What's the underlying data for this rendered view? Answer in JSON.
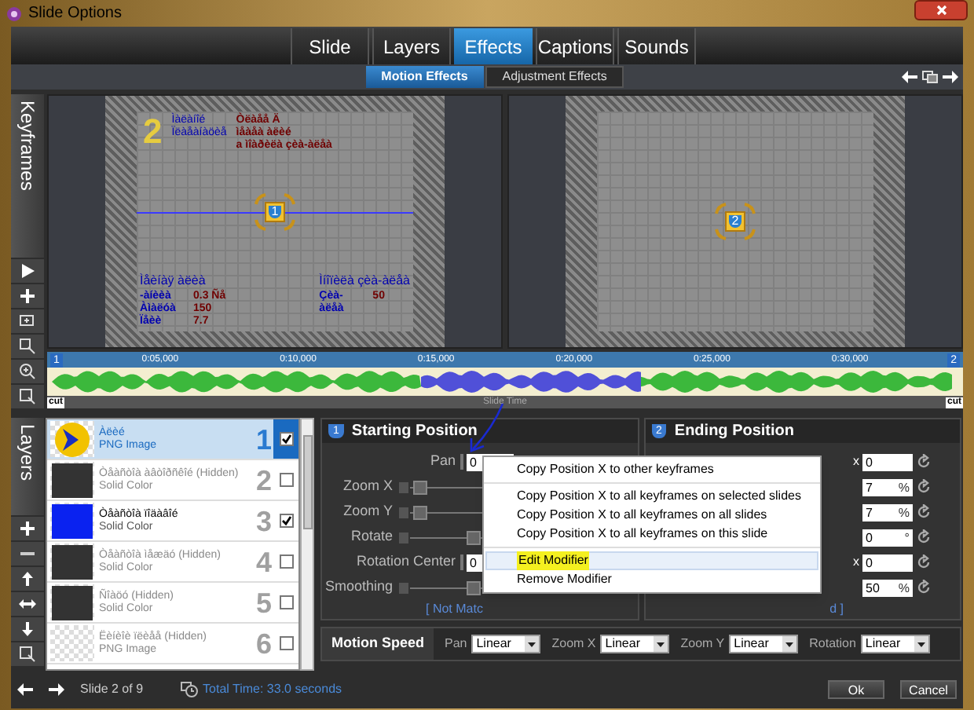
{
  "window": {
    "title": "Slide Options"
  },
  "tabs": [
    {
      "label": "Slide",
      "selected": false
    },
    {
      "label": "Layers",
      "selected": false
    },
    {
      "label": "Effects",
      "selected": true
    },
    {
      "label": "Captions",
      "selected": false
    },
    {
      "label": "Sounds",
      "selected": false
    }
  ],
  "subtabs": [
    {
      "label": "Motion Effects",
      "selected": true
    },
    {
      "label": "Adjustment Effects",
      "selected": false
    }
  ],
  "keyframes_label": "Keyframes",
  "preview": {
    "slide_number": "2",
    "title_lines": [
      "Ìàëàíîé",
      "Ïëàåàíàöèå"
    ],
    "red_lines": [
      "Òëàåå Ä",
      "ìåàåà àëèé",
      "a ìîàðèëà çèà-àëåà"
    ],
    "left_block": {
      "heading": "Ìåèíàÿ àëèà",
      "rows": [
        {
          "label": "-àíèèà",
          "value": "0.3 Ñå"
        },
        {
          "label": "Àìàëóà",
          "value": "150"
        },
        {
          "label": "Ïåèè",
          "value": "7.7"
        }
      ]
    },
    "right_block": {
      "heading": "Ìíîïèëà çèà-àëåà",
      "rows": [
        {
          "label": "Çèà-àëåà",
          "value": "50"
        }
      ]
    },
    "keyframes": [
      "1",
      "2"
    ]
  },
  "timeline": {
    "ticks": [
      "0:05,000",
      "0:10,000",
      "0:15,000",
      "0:20,000",
      "0:25,000",
      "0:30,000"
    ],
    "start_marker": "1",
    "end_marker": "2",
    "cut_labels": [
      "cut",
      "cut"
    ],
    "caption": "Slide Time"
  },
  "layers_label": "Layers",
  "layers": [
    {
      "name": "Àëèé",
      "type": "PNG Image",
      "number": "1",
      "checked": true,
      "selected": true,
      "kind": "chevron"
    },
    {
      "name": "Òåàñòîà àâòîðñêîé (Hidden)",
      "type": "Solid Color",
      "number": "2",
      "checked": false,
      "selected": false,
      "kind": "solid",
      "color": "#333333"
    },
    {
      "name": "Òåàñòîà ïîäàâîé",
      "type": "Solid Color",
      "number": "3",
      "checked": true,
      "selected": false,
      "kind": "solid",
      "color": "#0a22f0"
    },
    {
      "name": "Òåàñòîà ìåæäó (Hidden)",
      "type": "Solid Color",
      "number": "4",
      "checked": false,
      "selected": false,
      "kind": "solid",
      "color": "#333333"
    },
    {
      "name": "Ñîàöó (Hidden)",
      "type": "Solid Color",
      "number": "5",
      "checked": false,
      "selected": false,
      "kind": "solid",
      "color": "#333333"
    },
    {
      "name": "Ëèíèîè ïëèåå (Hidden)",
      "type": "PNG Image",
      "number": "6",
      "checked": false,
      "selected": false,
      "kind": "checker"
    }
  ],
  "starting_position": {
    "badge": "1",
    "title": "Starting Position",
    "rows": [
      {
        "kind": "field",
        "label": "Pan",
        "value": "0"
      },
      {
        "kind": "slider",
        "label": "Zoom X",
        "level": 0.03
      },
      {
        "kind": "slider",
        "label": "Zoom Y",
        "level": 0.03
      },
      {
        "kind": "slider",
        "label": "Rotate",
        "level": 0.5
      },
      {
        "kind": "field",
        "label": "Rotation Center",
        "value": "0"
      },
      {
        "kind": "slider",
        "label": "Smoothing",
        "level": 0.5
      }
    ],
    "note": "[ Not Matc"
  },
  "ending_position": {
    "badge": "2",
    "title": "Ending Position",
    "rows": [
      {
        "prefix": "x",
        "value": "0"
      },
      {
        "value": "7",
        "unit": "%"
      },
      {
        "value": "7",
        "unit": "%"
      },
      {
        "value": "0",
        "unit": "°"
      },
      {
        "prefix": "x",
        "value": "0"
      },
      {
        "value": "50",
        "unit": "%"
      }
    ],
    "note": "d ]"
  },
  "motion_speed": {
    "title": "Motion Speed",
    "fields": [
      {
        "label": "Pan",
        "value": "Linear"
      },
      {
        "label": "Zoom X",
        "value": "Linear"
      },
      {
        "label": "Zoom Y",
        "value": "Linear"
      },
      {
        "label": "Rotation",
        "value": "Linear"
      }
    ]
  },
  "context_menu": {
    "groups": [
      [
        {
          "label": "Copy Position X to other keyframes",
          "selected": false,
          "highlighted": false
        }
      ],
      [
        {
          "label": "Copy Position X to all keyframes on selected slides",
          "selected": false,
          "highlighted": false
        },
        {
          "label": "Copy Position X to all keyframes on all slides",
          "selected": false,
          "highlighted": false
        },
        {
          "label": "Copy Position X to all keyframes on this slide",
          "selected": false,
          "highlighted": false
        }
      ],
      [
        {
          "label": "Edit Modifier",
          "selected": true,
          "highlighted": true
        },
        {
          "label": "Remove Modifier",
          "selected": false,
          "highlighted": false
        }
      ]
    ]
  },
  "footer": {
    "slide": "Slide 2 of 9",
    "total_time": "Total Time: 33.0 seconds",
    "buttons": [
      "Ok",
      "Cancel"
    ]
  }
}
